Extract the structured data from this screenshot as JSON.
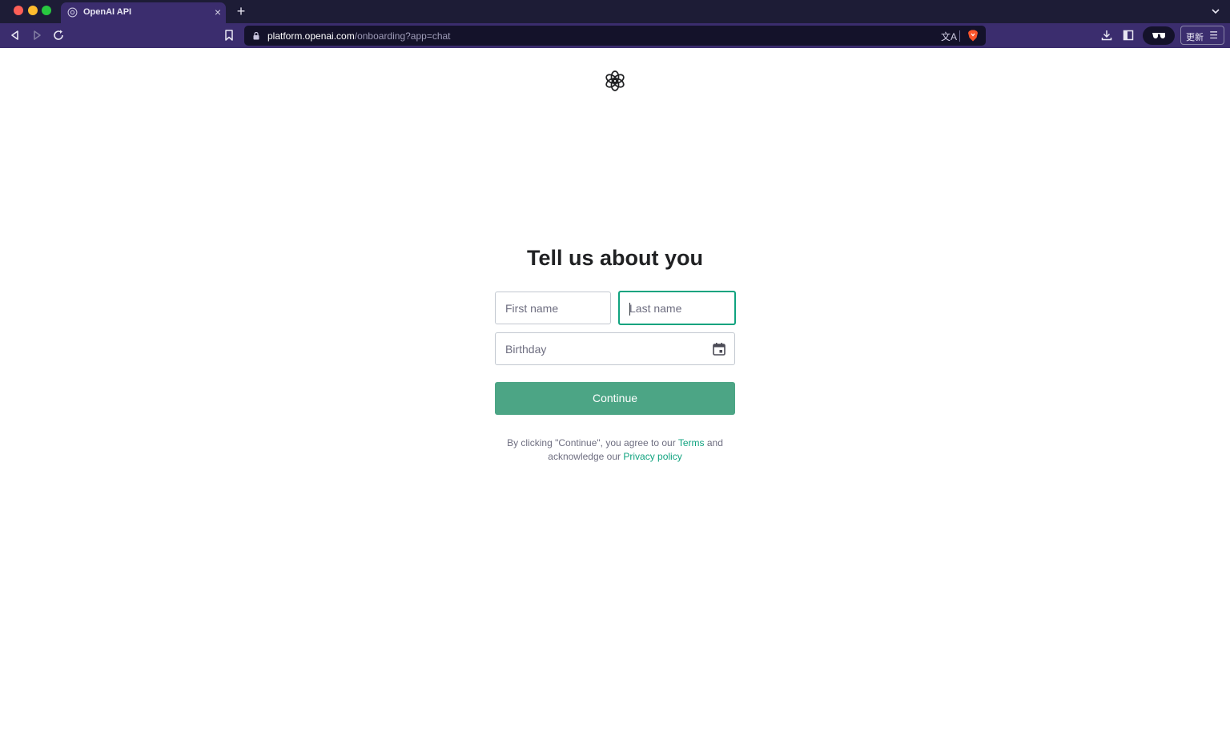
{
  "browser": {
    "tab": {
      "title": "OpenAI API",
      "close_glyph": "×"
    },
    "new_tab_glyph": "+",
    "url": {
      "host": "platform.openai.com",
      "path": "/onboarding?app=chat"
    },
    "translate_glyph": "文A",
    "update_label": "更新",
    "menu_glyph": "☰",
    "icons": [
      "back-icon",
      "forward-icon",
      "reload-icon",
      "bookmark-icon",
      "lock-icon",
      "translate-icon",
      "brave-shield-icon",
      "download-icon",
      "sidebar-icon",
      "glasses-icon",
      "chevron-down-icon"
    ]
  },
  "page": {
    "logo": "openai-logo",
    "heading": "Tell us about you",
    "first_name_placeholder": "First name",
    "last_name_placeholder": "Last name",
    "birthday_placeholder": "Birthday",
    "continue_label": "Continue",
    "legal": {
      "prefix": "By clicking \"Continue\", you agree to our",
      "terms_link": "Terms",
      "middle": "and acknowledge our",
      "privacy_link": "Privacy policy"
    }
  },
  "colors": {
    "accent": "#10a37f",
    "button": "#4ca585",
    "toolbar": "#3b2d6e",
    "titlebar": "#1d1c36"
  }
}
